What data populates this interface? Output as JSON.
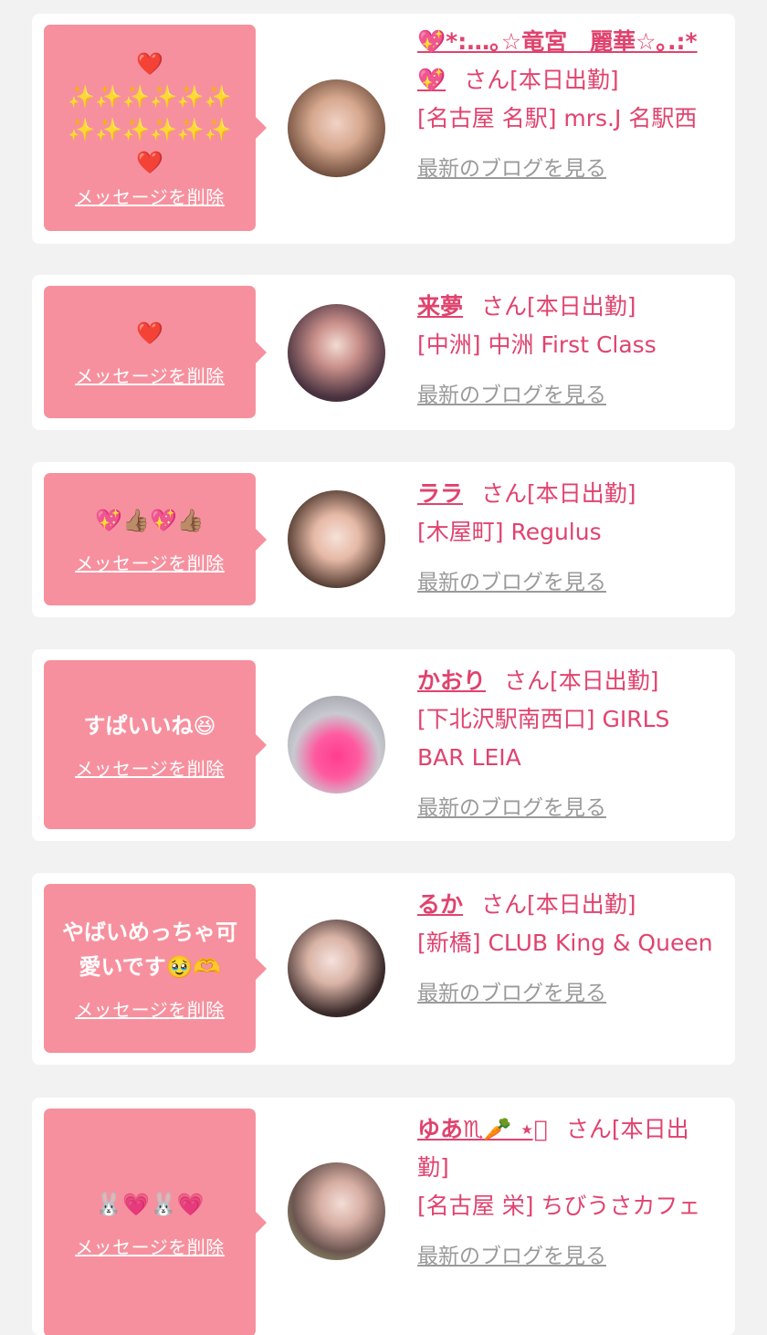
{
  "items": [
    {
      "message": "❤️\n✨✨✨✨✨✨\n✨✨✨✨✨✨\n❤️",
      "delete_label": "メッセージを削除",
      "name": "💖*:…｡☆竜宮　麗華☆｡.:*💖",
      "suffix": "さん[本日出勤]",
      "shop": "[名古屋 名駅] mrs.J 名駅西",
      "blog_label": "最新のブログを見る",
      "avatar": "profile-photo"
    },
    {
      "message": "❤️",
      "delete_label": "メッセージを削除",
      "name": "来夢",
      "suffix": "さん[本日出勤]",
      "shop": "[中洲] 中洲 First Class",
      "blog_label": "最新のブログを見る",
      "avatar": "profile-photo"
    },
    {
      "message": "💖👍🏽💖👍🏽",
      "delete_label": "メッセージを削除",
      "name": "ララ",
      "suffix": "さん[本日出勤]",
      "shop": "[木屋町] Regulus",
      "blog_label": "最新のブログを見る",
      "avatar": "profile-photo"
    },
    {
      "message": "すぱいいね😆",
      "delete_label": "メッセージを削除",
      "name": "かおり",
      "suffix": "さん[本日出勤]",
      "shop": "[下北沢駅南西口] GIRLS BAR LEIA",
      "blog_label": "最新のブログを見る",
      "avatar": "heart-sticker-photo"
    },
    {
      "message": "やばいめっちゃ可愛いです🥹🫶",
      "delete_label": "メッセージを削除",
      "name": "るか",
      "suffix": "さん[本日出勤]",
      "shop": "[新橋] CLUB King & Queen",
      "blog_label": "最新のブログを見る",
      "avatar": "profile-photo"
    },
    {
      "message": "🐰💗🐰💗",
      "delete_label": "メッセージを削除",
      "name": "ゆあ♏︎🥕 ⋆͛",
      "suffix": "さん[本日出勤]",
      "shop": "[名古屋 栄] ちびうさカフェ",
      "blog_label": "最新のブログを見る",
      "avatar": "profile-photo"
    }
  ],
  "colors": {
    "accent": "#e0436e",
    "bubble": "#f7909e",
    "card": "#ffffff",
    "background": "#f2f2f3"
  }
}
